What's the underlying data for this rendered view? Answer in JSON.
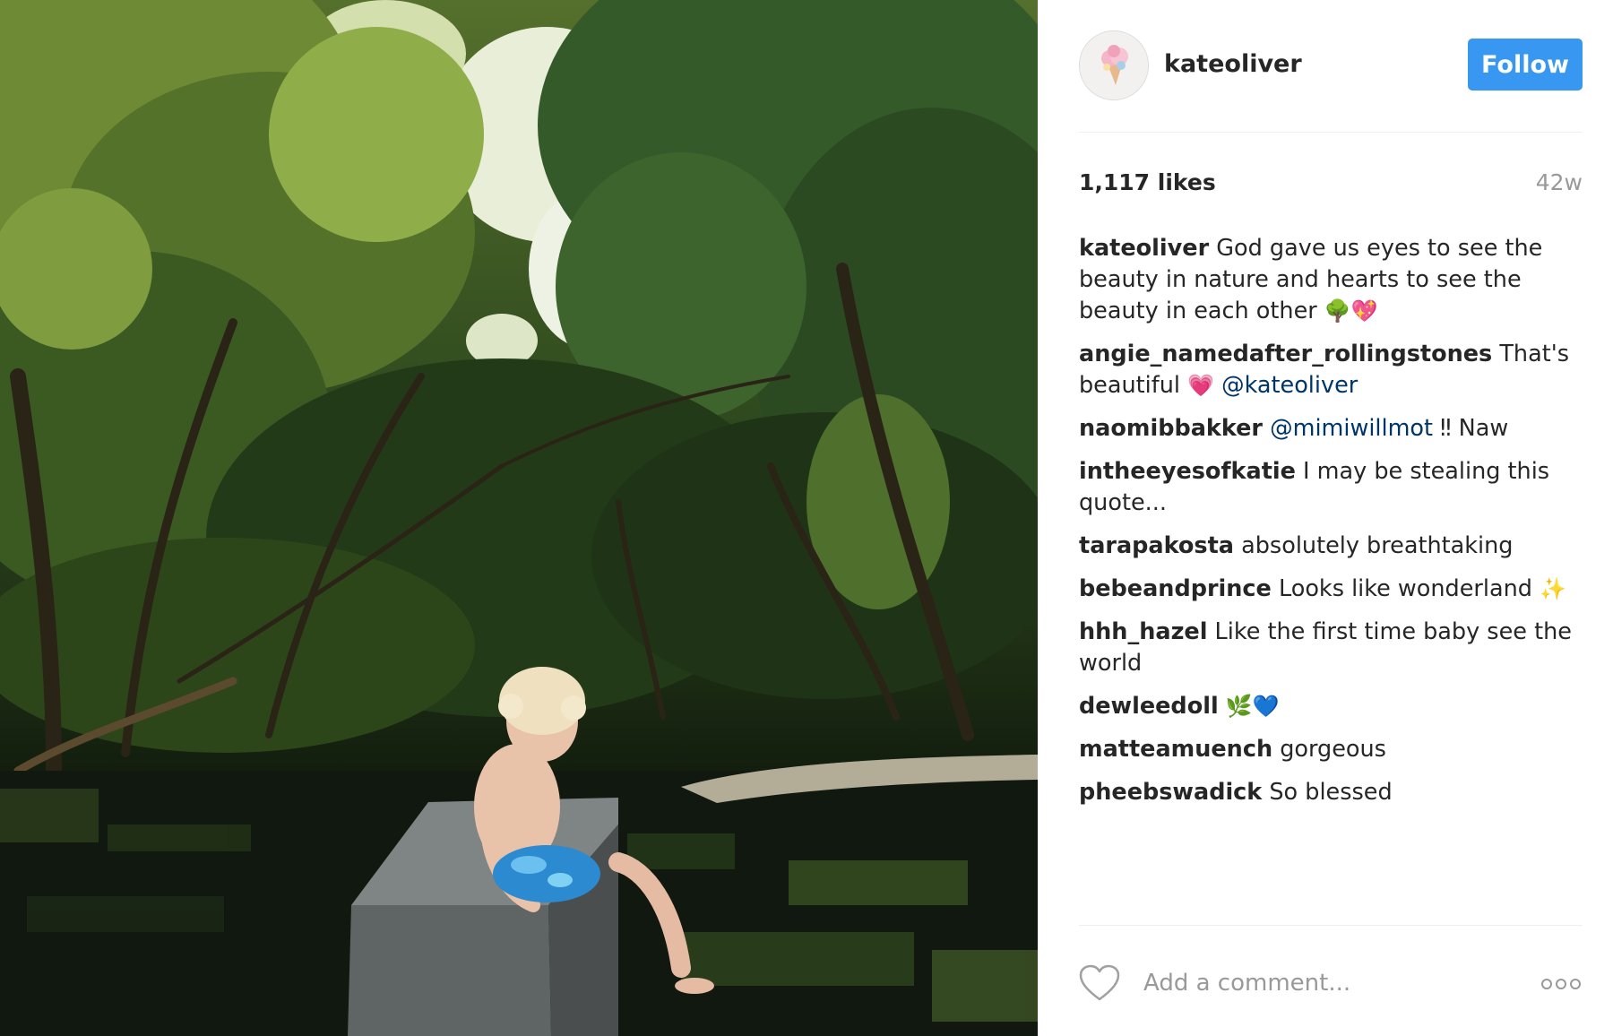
{
  "post": {
    "username": "kateoliver",
    "follow_label": "Follow",
    "likes": "1,117 likes",
    "age": "42w",
    "photo_description": "Child sitting on a stone wall over a forest creek under tree canopy"
  },
  "comments": [
    {
      "user": "kateoliver",
      "text": " God gave us eyes to see the beauty in nature and hearts to see the beauty in each other ",
      "emoji": "🌳💖"
    },
    {
      "user": "angie_namedafter_rollingstones",
      "text": " That's beautiful ",
      "emoji": "💗",
      "mention": " @kateoliver"
    },
    {
      "user": "naomibbakker",
      "mention": " @mimiwillmot",
      "text": " ‼ Naw"
    },
    {
      "user": "intheeyesofkatie",
      "text": " I may be stealing this quote..."
    },
    {
      "user": "tarapakosta",
      "text": " absolutely breathtaking"
    },
    {
      "user": "bebeandprince",
      "text": " Looks like wonderland ",
      "emoji": "✨"
    },
    {
      "user": "hhh_hazel",
      "text": " Like the first time baby see the world"
    },
    {
      "user": "dewleedoll",
      "text": " ",
      "emoji": "🌿💙"
    },
    {
      "user": "matteamuench",
      "text": " gorgeous"
    },
    {
      "user": "pheebswadick",
      "text": " So blessed"
    }
  ],
  "comment_bar": {
    "placeholder": "Add a comment...",
    "like_icon": "heart-outline-icon",
    "more_icon": "more-options-icon"
  },
  "colors": {
    "follow_button": "#3897f0",
    "mention": "#003569",
    "muted": "#999999",
    "divider": "#efefef"
  }
}
